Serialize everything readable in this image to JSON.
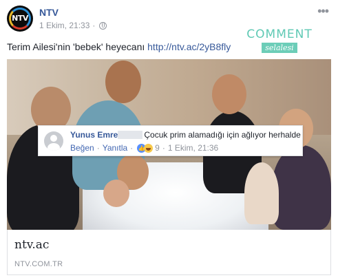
{
  "page": {
    "name": "NTV",
    "avatar_text": "NTV",
    "timestamp": "1 Ekim, 21:33",
    "separator": "·",
    "more_glyph": "•••"
  },
  "watermark": {
    "title": "COMMENT",
    "subtitle": "selalesi",
    "color": "#5fc9b4"
  },
  "post": {
    "text": "Terim Ailesi'nin 'bebek' heyecanı ",
    "link": "http://ntv.ac/2yB8fly"
  },
  "comment": {
    "author": "Yunus Emre",
    "text": "Çocuk prim alamadığı için ağlıyor herhalde",
    "like_label": "Beğen",
    "reply_label": "Yanıtla",
    "dot": "·",
    "reaction_count": "9",
    "timestamp": "1 Ekim, 21:36"
  },
  "link_preview": {
    "title": "ntv.ac",
    "domain": "NTV.COM.TR"
  },
  "colors": {
    "link": "#365899",
    "muted": "#90949c",
    "text": "#1d2129"
  }
}
